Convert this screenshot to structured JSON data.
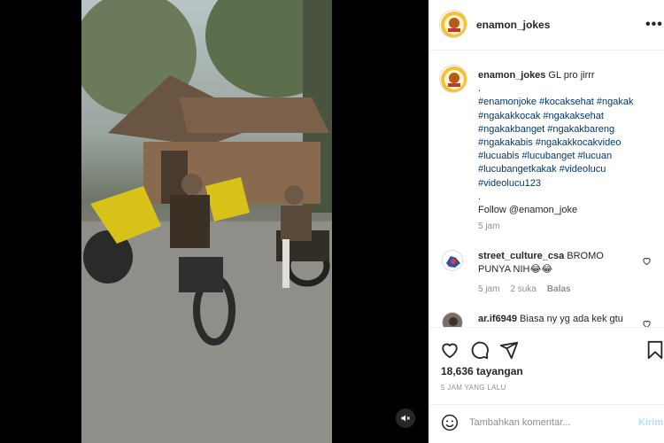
{
  "post": {
    "username": "enamon_jokes",
    "more_label": "•••"
  },
  "caption": {
    "username": "enamon_jokes",
    "text": "GL pro jirrr",
    "dot1": ".",
    "hashtags": [
      "#enamonjoke #kocaksehat #ngakak",
      "#ngakakkocak #ngakaksehat",
      "#ngakakbanget #ngakakbareng",
      "#ngakakabis #ngakakkocakvideo",
      "#lucuabis #lucubanget #lucuan",
      "#lucubangetkakak #videolucu",
      "#videolucu123"
    ],
    "dot2": ".",
    "follow": "Follow @enamon_joke",
    "time": "5 jam"
  },
  "comments": [
    {
      "username": "street_culture_csa",
      "text": "BROMO PUNYA NIH😂😂",
      "time": "5 jam",
      "likes": "2 suka",
      "reply": "Balas"
    },
    {
      "username": "ar.if6949",
      "text": "Biasa ny yg ada kek gtu"
    }
  ],
  "stats": {
    "views": "18,636 tayangan",
    "posted": "5 JAM YANG LALU"
  },
  "comment_form": {
    "placeholder": "Tambahkan komentar...",
    "post_label": "Kirim"
  },
  "icons": {
    "like": "heart-icon",
    "comment": "comment-icon",
    "share": "share-icon",
    "save": "bookmark-icon",
    "emoji": "emoji-icon",
    "mute": "speaker-muted-icon"
  }
}
